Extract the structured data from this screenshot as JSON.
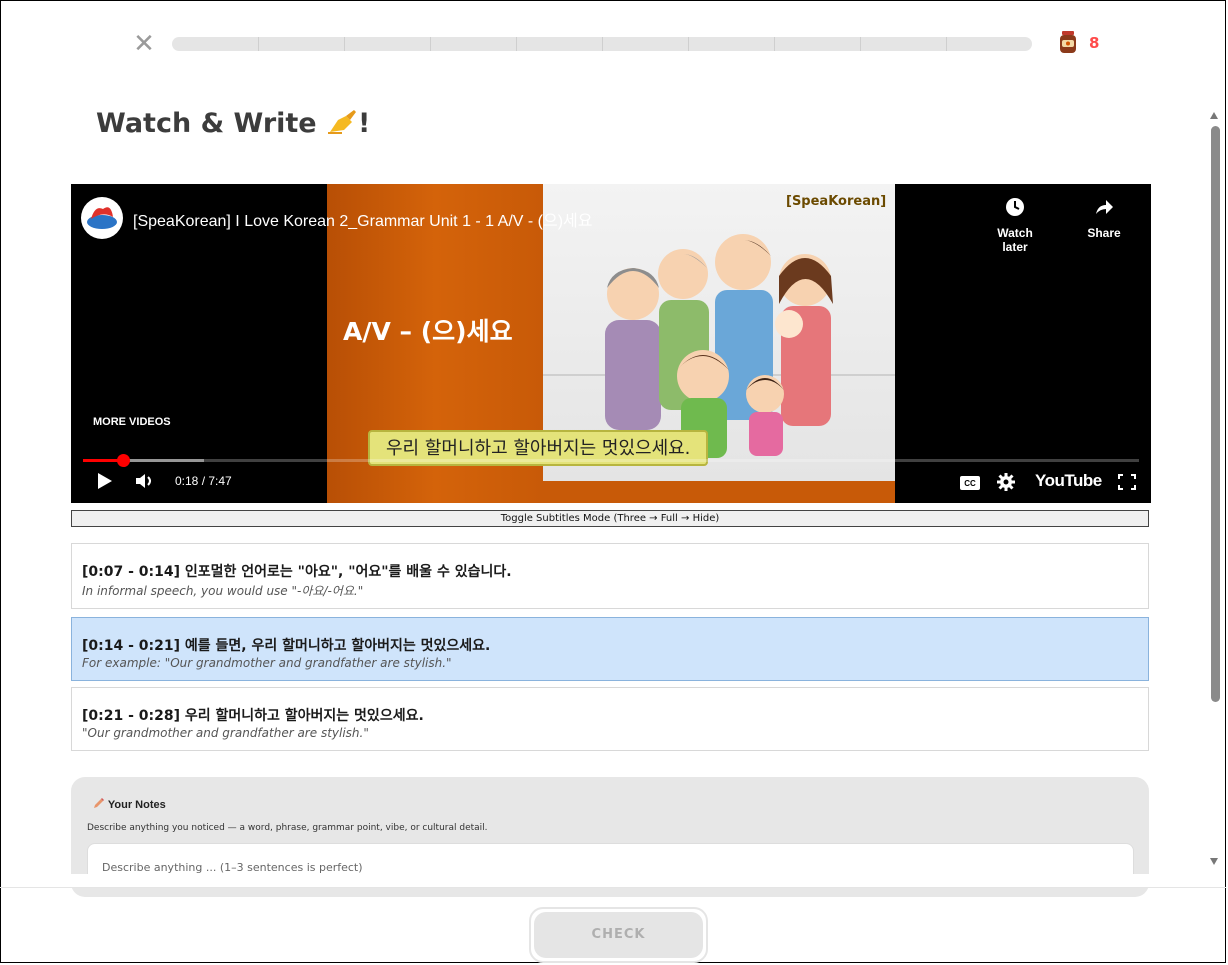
{
  "header": {
    "close_icon": "close-icon",
    "lives_icon": "jar-icon",
    "lives_count": "8",
    "progress_segments": 10,
    "progress_value": 0
  },
  "title": {
    "text": "Watch & Write",
    "suffix": "!",
    "emoji_icon": "writing-hand-icon"
  },
  "video": {
    "title": "[SpeaKorean] I Love Korean 2_Grammar Unit 1 - 1 A/V - (으)세요",
    "brand": "[SpeaKorean]",
    "slide_text": "A/V – (으)세요",
    "watch_later": "Watch later",
    "share": "Share",
    "more_videos": "MORE VIDEOS",
    "subtitle": "우리 할머니하고 할아버지는 멋있으세요.",
    "time": "0:18 / 7:47",
    "progress": 0.038,
    "youtube": "YouTube",
    "icons": {
      "play": "play-icon",
      "volume": "volume-icon",
      "cc": "cc-icon",
      "settings": "gear-icon",
      "fullscreen": "fullscreen-icon",
      "clock": "clock-icon",
      "share": "share-icon"
    }
  },
  "toggle": {
    "label": "Toggle Subtitles Mode (Three → Full → Hide)"
  },
  "cues": [
    {
      "time": "[0:07 - 0:14]",
      "ko": "인포멀한 언어로는 \"아요\", \"어요\"를 배울 수 있습니다.",
      "en": "In informal speech, you would use \"-아요/-어요.\"",
      "active": false
    },
    {
      "time": "[0:14 - 0:21]",
      "ko": "예를 들면, 우리 할머니하고 할아버지는 멋있으세요.",
      "en": "For example: \"Our grandmother and grandfather are stylish.\"",
      "active": true
    },
    {
      "time": "[0:21 - 0:28]",
      "ko": "우리 할머니하고 할아버지는 멋있으세요.",
      "en": "\"Our grandmother and grandfather are stylish.\"",
      "active": false
    }
  ],
  "notes": {
    "heading": "Your Notes",
    "description": "Describe anything you noticed — a word, phrase, grammar point, vibe, or cultural detail.",
    "placeholder": "Describe anything ... (1–3 sentences is perfect)",
    "icon": "pencil-icon"
  },
  "footer": {
    "check_label": "CHECK"
  }
}
